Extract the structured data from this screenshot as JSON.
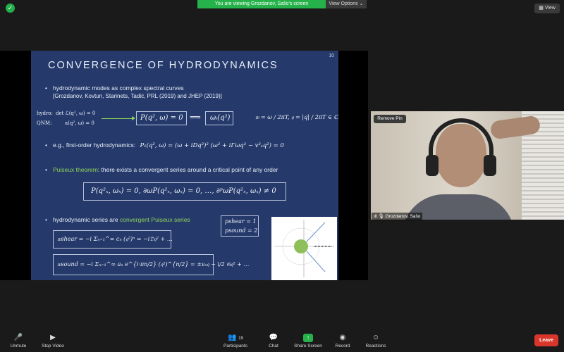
{
  "top_bar": {
    "banner_text": "You are viewing Grozdanov, Sašo's screen",
    "view_options_label": "View Options ⌄",
    "view_button_label": "View"
  },
  "slide": {
    "number": "10",
    "title": "CONVERGENCE OF HYDRODYNAMICS",
    "bullet1": "hydrodynamic modes as complex spectral curves",
    "citation": "[Grozdanov, Kovtun, Starinets, Tadić, PRL (2019) and JHEP (2019)]",
    "hydro_label": "hydro:",
    "hydro_eq": "det ℒ(q², ω) = 0",
    "qnm_label": "QNM:",
    "qnm_eq": "a(q², ω) = 0",
    "spectral_curve": "P(q², ω) = 0",
    "implies": "⟹",
    "mode_fn": "ωᵢ(q²)",
    "variables": "𝔴 = ω / 2πT,  𝔮 = |q| / 2πT  ∈ ℂ",
    "bullet2_prefix": "e.g., first-order hydrodynamics:",
    "bullet2_eq": "P₁(q², ω) = (ω + iDq²)² (ω² + iΓωq² − v²ₛq²) = 0",
    "bullet3_green": "Puiseux theorem",
    "bullet3_rest": ": there exists a convergent series around a critical point of any order",
    "puiseux_eq": "P(q²ₓ, ωₓ) = 0, ∂ωP(q²ₓ, ωₓ) = 0, …, ∂ᵖωP(q²ₓ, ωₓ) ≠ 0",
    "bullet4_prefix": "hydrodynamic series are",
    "bullet4_green": "convergent Puiseux series",
    "p_shear": "pshear = 1",
    "p_sound": "psound = 2",
    "shear_series": "𝔴shear = −i Σₙ₌₁^∞ cₙ (𝔮²)ⁿ = −i𝔇𝔮² + …",
    "sound_series": "𝔴sound = −i Σₙ₌₁^∞ aₙ e^{i·πn/2} (𝔮²)^{n/2} = ±vₛ𝔮 − i/2 𝔊𝔮² + …"
  },
  "participant": {
    "remove_pin_label": "Remove Pin",
    "name": "Grozdanov, Sašo"
  },
  "toolbar": {
    "unmute": "Unmute",
    "stop_video": "Stop Video",
    "participants": "Participants",
    "participants_count": "19",
    "chat": "Chat",
    "share_screen": "Share Screen",
    "record": "Record",
    "reactions": "Reactions",
    "leave": "Leave"
  },
  "colors": {
    "slide_bg": "#253a6b",
    "accent_green": "#8fd45a",
    "zoom_green": "#26b24a",
    "leave_red": "#d9362b"
  }
}
